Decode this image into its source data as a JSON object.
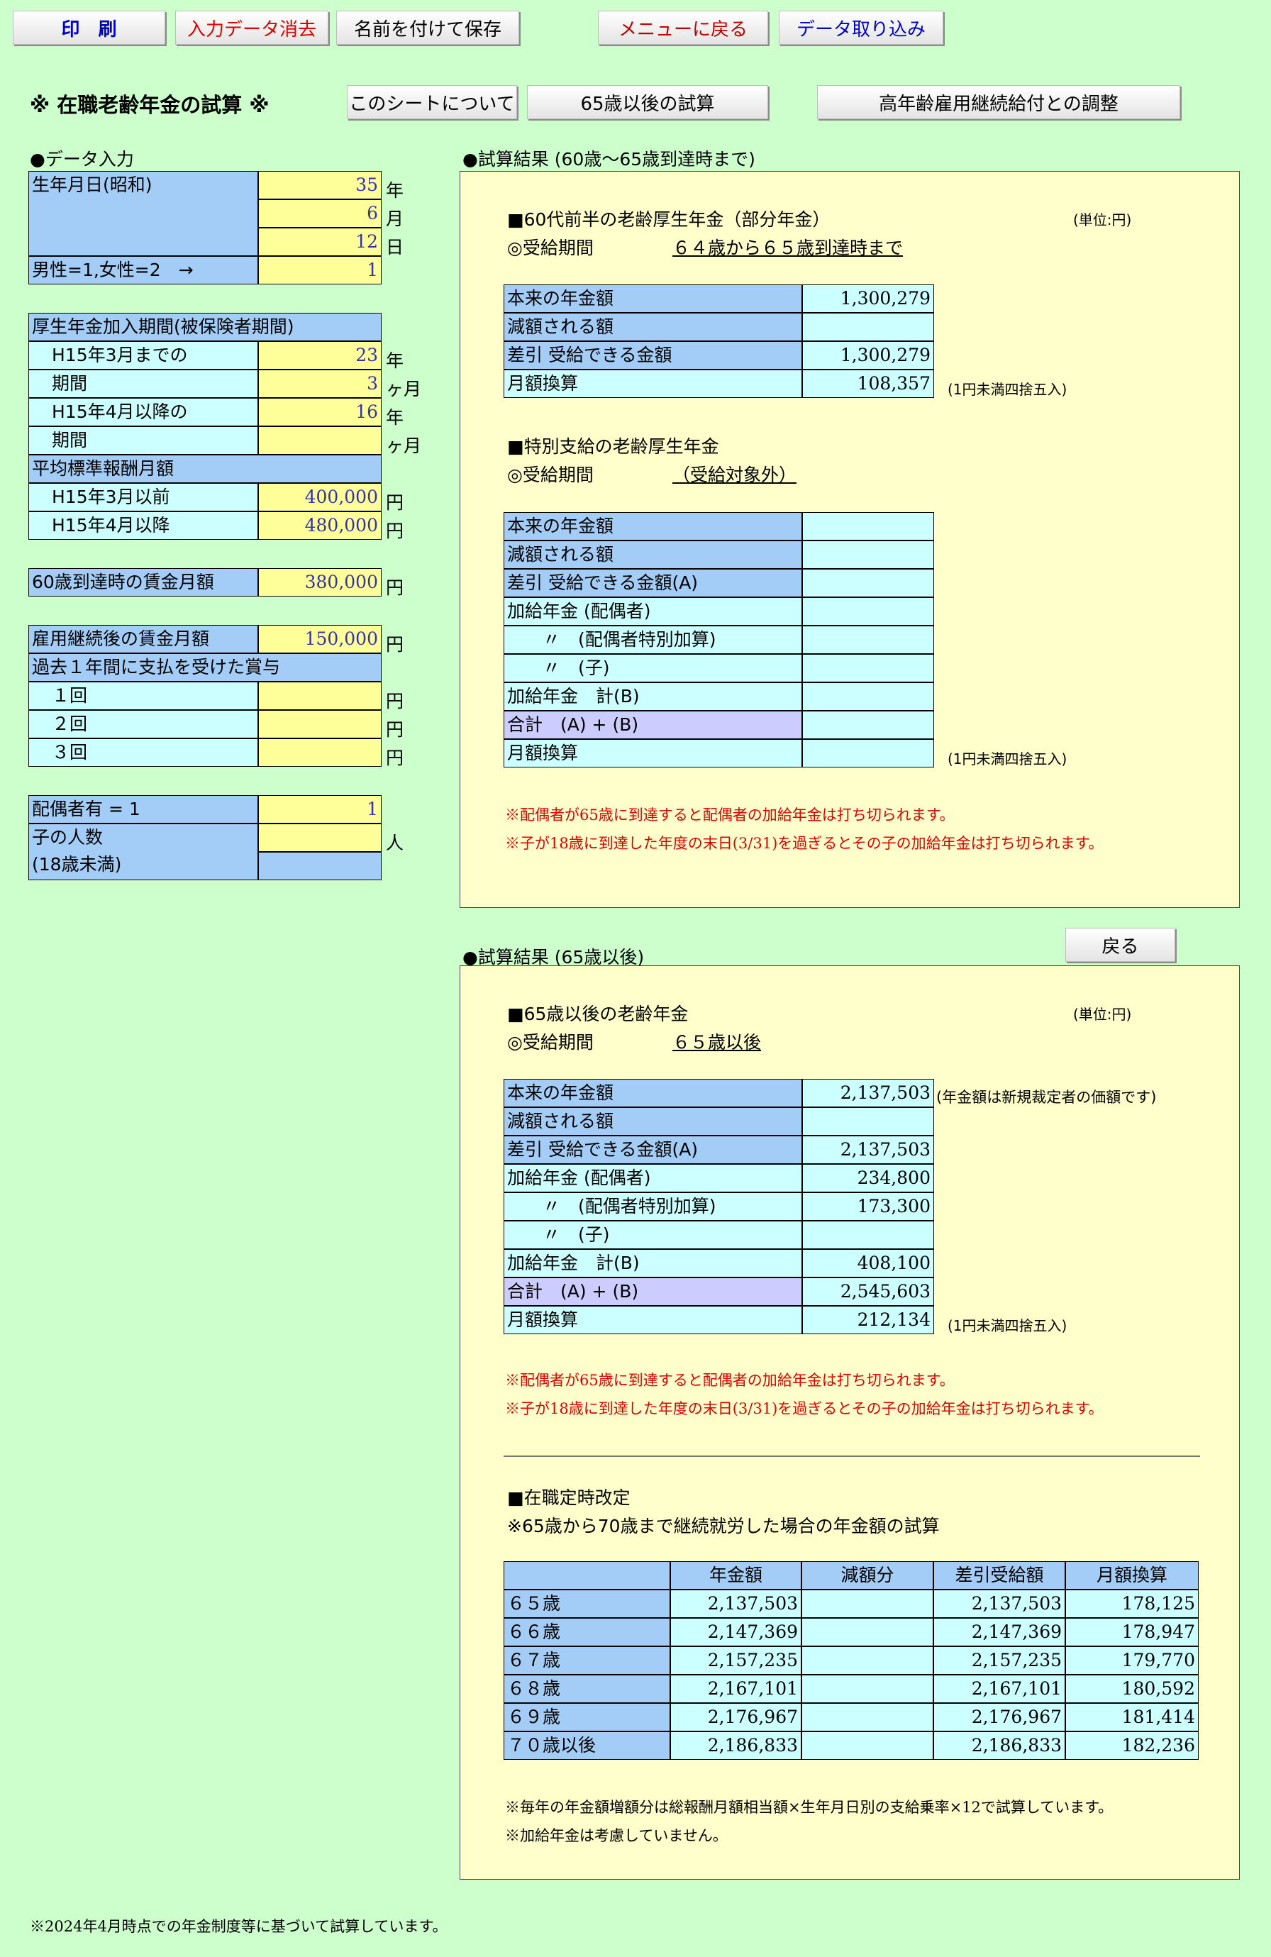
{
  "toolbar": {
    "print": "印　刷",
    "clear": "入力データ消去",
    "save": "名前を付けて保存",
    "menu": "メニューに戻る",
    "import": "データ取り込み"
  },
  "header": {
    "title": "※ 在職老齢年金の試算 ※",
    "about": "このシートについて",
    "after65": "65歳以後の試算",
    "adjust": "高年齢雇用継続給付との調整"
  },
  "input": {
    "heading": "●データ入力",
    "birth_label": "生年月日(昭和)",
    "birth_year": "35",
    "birth_month": "6",
    "birth_day": "12",
    "u_year": "年",
    "u_month": "月",
    "u_day": "日",
    "gender_label": "男性=1,女性=2　→",
    "gender": "1",
    "period_label": "厚生年金加入期間(被保険者期間)",
    "h15_before_l1": "H15年3月までの",
    "h15_before_l2": "期間",
    "h15_before_years": "23",
    "h15_before_months": "3",
    "h15_after_l1": "H15年4月以降の",
    "h15_after_l2": "期間",
    "h15_after_years": "16",
    "h15_after_months": "",
    "u_years": "年",
    "u_kagetsu": "ヶ月",
    "avg_label": "平均標準報酬月額",
    "avg_before_label": "H15年3月以前",
    "avg_before": "400,000",
    "avg_after_label": "H15年4月以降",
    "avg_after": "480,000",
    "u_yen": "円",
    "wage60_label": "60歳到達時の賃金月額",
    "wage60": "380,000",
    "wage_after_label": "雇用継続後の賃金月額",
    "wage_after": "150,000",
    "bonus_label": "過去１年間に支払を受けた賞与",
    "bonus1": "１回",
    "bonus2": "２回",
    "bonus3": "３回",
    "spouse_label": "配偶者有 = 1",
    "spouse": "1",
    "children_label": "子の人数",
    "children_sub": "(18歳未満)",
    "u_person": "人"
  },
  "result1": {
    "heading": "●試算結果 (60歳～65歳到達時まで)",
    "sec1_title": "■60代前半の老齢厚生年金（部分年金）",
    "unit_note": "(単位:円)",
    "period_label": "◎受給期間",
    "sec1_period": "６４歳から６５歳到達時まで",
    "t1": [
      {
        "label": "本来の年金額",
        "value": "1,300,279"
      },
      {
        "label": "減額される額",
        "value": ""
      },
      {
        "label": "差引 受給できる金額",
        "value": "1,300,279"
      },
      {
        "label": "月額換算",
        "value": "108,357"
      }
    ],
    "round_note": "(1円未満四捨五入)",
    "sec2_title": "■特別支給の老齢厚生年金",
    "sec2_period": "（受給対象外）",
    "t2": [
      {
        "label": "本来の年金額",
        "value": ""
      },
      {
        "label": "減額される額",
        "value": ""
      },
      {
        "label": "差引 受給できる金額(A)",
        "value": ""
      },
      {
        "label": "加給年金 (配偶者)",
        "value": ""
      },
      {
        "label": "　　〃　(配偶者特別加算)",
        "value": ""
      },
      {
        "label": "　　〃　(子)",
        "value": ""
      },
      {
        "label": "加給年金　計(B)",
        "value": ""
      },
      {
        "label": "合計　(A) + (B)",
        "value": ""
      },
      {
        "label": "月額換算",
        "value": ""
      }
    ],
    "warn1": "※配偶者が65歳に到達すると配偶者の加給年金は打ち切られます。",
    "warn2": "※子が18歳に到達した年度の末日(3/31)を過ぎるとその子の加給年金は打ち切られます。"
  },
  "result2": {
    "back": "戻る",
    "heading": "●試算結果 (65歳以後)",
    "title": "■65歳以後の老齢年金",
    "unit_note": "(単位:円)",
    "period_label": "◎受給期間",
    "period": "６５歳以後",
    "t": [
      {
        "label": "本来の年金額",
        "value": "2,137,503"
      },
      {
        "label": "減額される額",
        "value": ""
      },
      {
        "label": "差引 受給できる金額(A)",
        "value": "2,137,503"
      },
      {
        "label": "加給年金 (配偶者)",
        "value": "234,800"
      },
      {
        "label": "　　〃　(配偶者特別加算)",
        "value": "173,300"
      },
      {
        "label": "　　〃　(子)",
        "value": ""
      },
      {
        "label": "加給年金　計(B)",
        "value": "408,100"
      },
      {
        "label": "合計　(A) + (B)",
        "value": "2,545,603"
      },
      {
        "label": "月額換算",
        "value": "212,134"
      }
    ],
    "new_note": "(年金額は新規裁定者の価額です)",
    "round_note": "(1円未満四捨五入)",
    "warn1": "※配偶者が65歳に到達すると配偶者の加給年金は打ち切られます。",
    "warn2": "※子が18歳に到達した年度の末日(3/31)を過ぎるとその子の加給年金は打ち切られます。",
    "rev_title": "■在職定時改定",
    "rev_sub": "※65歳から70歳まで継続就労した場合の年金額の試算",
    "rev_headers": [
      "",
      "年金額",
      "減額分",
      "差引受給額",
      "月額換算"
    ],
    "rev_rows": [
      {
        "age": "６５歳",
        "amount": "2,137,503",
        "reduce": "",
        "net": "2,137,503",
        "monthly": "178,125"
      },
      {
        "age": "６６歳",
        "amount": "2,147,369",
        "reduce": "",
        "net": "2,147,369",
        "monthly": "178,947"
      },
      {
        "age": "６７歳",
        "amount": "2,157,235",
        "reduce": "",
        "net": "2,157,235",
        "monthly": "179,770"
      },
      {
        "age": "６８歳",
        "amount": "2,167,101",
        "reduce": "",
        "net": "2,167,101",
        "monthly": "180,592"
      },
      {
        "age": "６９歳",
        "amount": "2,176,967",
        "reduce": "",
        "net": "2,176,967",
        "monthly": "181,414"
      },
      {
        "age": "７０歳以後",
        "amount": "2,186,833",
        "reduce": "",
        "net": "2,186,833",
        "monthly": "182,236"
      }
    ],
    "foot1": "※毎年の年金額増額分は総報酬月額相当額×生年月日別の支給乗率×12で試算しています。",
    "foot2": "※加給年金は考慮していません。"
  },
  "footer": "※2024年4月時点での年金制度等に基づいて試算しています。",
  "colors": {
    "background": "#ccffcc",
    "panel": "#ffffcc",
    "label_blue": "#a3cdf7",
    "cyan": "#ccffff",
    "input_yellow": "#ffff99",
    "total": "#ccccff"
  }
}
